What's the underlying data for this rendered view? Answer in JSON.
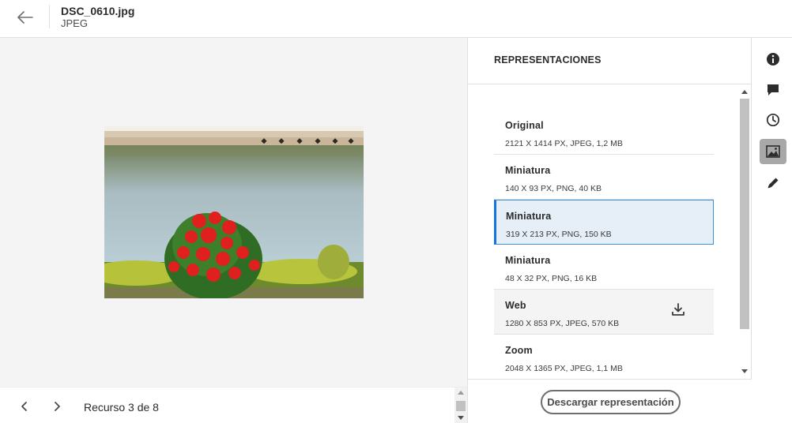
{
  "header": {
    "file_name": "DSC_0610.jpg",
    "file_type": "JPEG",
    "icons": {
      "back": "arrow-left-icon"
    }
  },
  "preview": {
    "image_description_icon": "landscape-photo"
  },
  "bottom_bar": {
    "resource_count": "Recurso 3 de 8",
    "icons": {
      "prev": "chevron-left-icon",
      "next": "chevron-right-icon"
    }
  },
  "panel": {
    "title": "REPRESENTACIONES",
    "renditions": [
      {
        "name": "Original",
        "meta": "2121 X 1414 PX, JPEG, 1,2 MB"
      },
      {
        "name": "Miniatura",
        "meta": "140 X 93 PX, PNG, 40 KB"
      },
      {
        "name": "Miniatura",
        "meta": "319 X 213 PX, PNG, 150 KB"
      },
      {
        "name": "Miniatura",
        "meta": "48 X 32 PX, PNG, 16 KB"
      },
      {
        "name": "Web",
        "meta": "1280 X 853 PX, JPEG, 570 KB"
      },
      {
        "name": "Zoom",
        "meta": "2048 X 1365 PX, JPEG, 1,1 MB"
      }
    ],
    "selected_index": 2,
    "hover_index": 4,
    "download_button": "Descargar representación"
  },
  "rail": {
    "icons": [
      "info-icon",
      "comment-icon",
      "history-icon",
      "image-icon",
      "edit-icon"
    ],
    "active": "image-icon"
  },
  "colors": {
    "accent": "#1473e6",
    "selected_bg": "#e6eef8",
    "preview_bg": "#f4f4f4"
  }
}
